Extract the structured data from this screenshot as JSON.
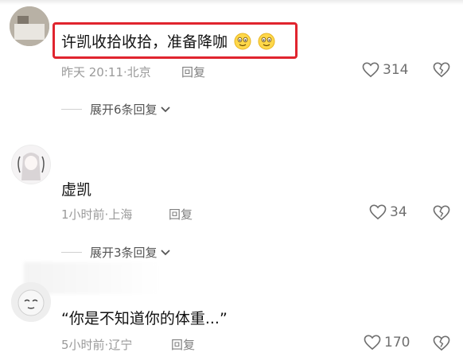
{
  "comments": [
    {
      "username": "",
      "text": "许凯收拾收拾，准备降咖",
      "time": "昨天 20:11",
      "location": "北京",
      "reply_label": "回复",
      "likes": "314",
      "expand_label": "展开6条回复"
    },
    {
      "username": "",
      "text": "虚凯",
      "time": "1小时前",
      "location": "上海",
      "reply_label": "回复",
      "likes": "34",
      "expand_label": "展开3条回复"
    },
    {
      "username": "",
      "text": "“你是不知道你的体重...”",
      "time": "5小时前",
      "location": "辽宁",
      "reply_label": "回复",
      "likes": "170"
    }
  ],
  "icons": {
    "like": "heart-outline-icon",
    "dislike": "broken-heart-icon",
    "expand": "chevron-down-icon",
    "emoji": "smiling-face-emoji"
  },
  "colors": {
    "highlight_border": "#e0242e",
    "meta_text": "#9a9a9a",
    "icon_gray": "#6f6f6f"
  }
}
